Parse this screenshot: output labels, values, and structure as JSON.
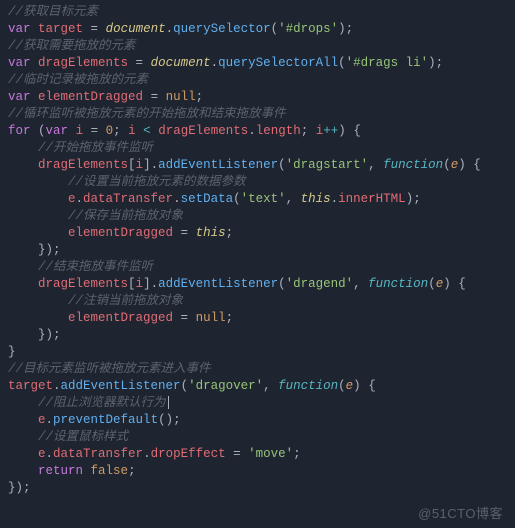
{
  "watermark": "@51CTO博客",
  "code": {
    "c1": "//获取目标元素",
    "kw_var": "var",
    "target": "target",
    "eq": " = ",
    "doc": "document",
    "dot": ".",
    "qs": "querySelector",
    "lp": "(",
    "rp": ")",
    "s_drops": "'#drops'",
    "semi": ";",
    "c2": "//获取需要拖放的元素",
    "dragElements": "dragElements",
    "qsa": "querySelectorAll",
    "s_drags": "'#drags li'",
    "c3": "//临时记录被拖放的元素",
    "elementDragged": "elementDragged",
    "nullv": "null",
    "c4": "//循环监听被拖放元素的开始拖放和结束拖放事件",
    "kw_for": "for",
    "sp": " ",
    "i": "i",
    "zero": "0",
    "lt": " < ",
    "length": "length",
    "pp": "++",
    "lb": "{",
    "rb": "}",
    "c5": "//开始拖放事件监听",
    "lbr": "[",
    "rbr": "]",
    "ael": "addEventListener",
    "s_dragstart": "'dragstart'",
    "comma": ", ",
    "fnk": "function",
    "e": "e",
    "c6": "//设置当前拖放元素的数据参数",
    "dataTransfer": "dataTransfer",
    "setData": "setData",
    "s_text": "'text'",
    "thisv": "this",
    "innerHTML": "innerHTML",
    "c7": "//保存当前拖放对象",
    "rpb": "})",
    "c8": "//结束拖放事件监听",
    "s_dragend": "'dragend'",
    "c9": "//注销当前拖放对象",
    "c10": "//目标元素监听被拖放元素进入事件",
    "s_dragover": "'dragover'",
    "c11": "//阻止浏览器默认行为",
    "preventDefault": "preventDefault",
    "c12": "//设置鼠标样式",
    "dropEffect": "dropEffect",
    "s_move": "'move'",
    "kw_return": "return",
    "falsev": "false"
  }
}
